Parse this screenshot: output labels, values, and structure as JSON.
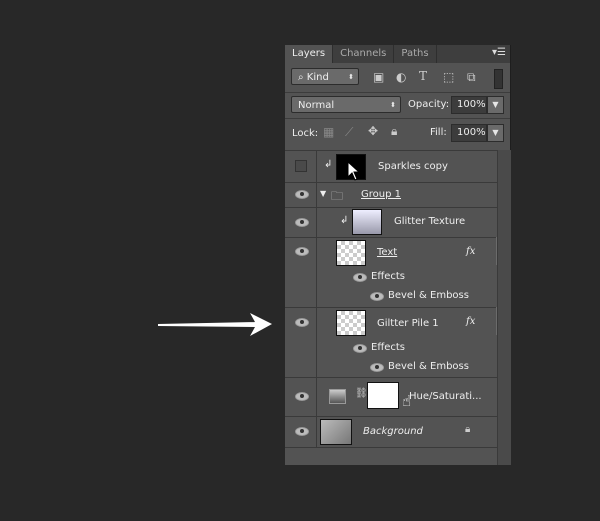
{
  "tabs": [
    {
      "label": "Layers"
    },
    {
      "label": "Channels"
    },
    {
      "label": "Paths"
    }
  ],
  "filter": {
    "kind_label": "Kind",
    "icons": [
      "image-filter-icon",
      "adjustment-filter-icon",
      "type-filter-icon",
      "shape-filter-icon",
      "smart-object-filter-icon"
    ]
  },
  "blend": {
    "mode": "Normal",
    "opacity_label": "Opacity:",
    "opacity": "100%"
  },
  "lock": {
    "label": "Lock:",
    "fill_label": "Fill:",
    "fill": "100%"
  },
  "layers": [
    {
      "name": "Sparkles copy",
      "visible": false,
      "clipped": true
    },
    {
      "name": "Group 1",
      "type": "group",
      "visible": true
    },
    {
      "name": "Glitter Texture",
      "visible": true,
      "clipped": true
    },
    {
      "name": "Text",
      "visible": true,
      "fx": "fx",
      "effects_label": "Effects",
      "effect": "Bevel & Emboss"
    },
    {
      "name": "Giltter Pile 1",
      "visible": true,
      "fx": "fx",
      "effects_label": "Effects",
      "effect": "Bevel & Emboss"
    },
    {
      "name": "Hue/Saturati...",
      "visible": true,
      "type": "adjustment"
    },
    {
      "name": "Background",
      "visible": true,
      "locked": true
    }
  ],
  "colors": {
    "panel": "#535353",
    "background": "#282828",
    "arrow": "#ffffff"
  }
}
